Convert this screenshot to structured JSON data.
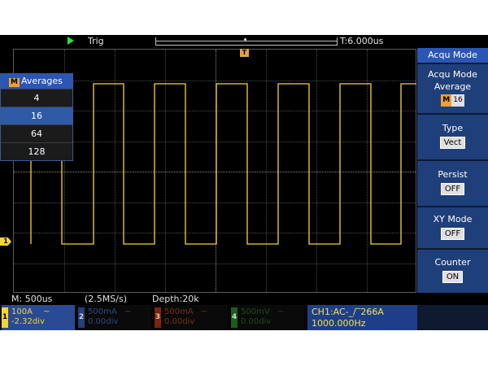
{
  "top": {
    "trigger_status": "Trig",
    "trigger_time": "T:6.000us"
  },
  "markers": {
    "trigger": "T",
    "ch1": "1"
  },
  "averages_menu": {
    "badge": "M",
    "title": "Averages",
    "options": [
      "4",
      "16",
      "64",
      "128"
    ],
    "selected": "16"
  },
  "right_menu": {
    "title": "Acqu Mode",
    "acqu_mode_label": "Acqu Mode",
    "acqu_mode_value": "Average",
    "acqu_mode_badge": "M",
    "acqu_mode_count": "16",
    "type_label": "Type",
    "type_value": "Vect",
    "persist_label": "Persist",
    "persist_value": "OFF",
    "xy_label": "XY Mode",
    "xy_value": "OFF",
    "counter_label": "Counter",
    "counter_value": "ON"
  },
  "info": {
    "timebase": "M: 500us",
    "sample_rate": "(2.5MS/s)",
    "depth": "Depth:20k"
  },
  "channels": [
    {
      "num": "1",
      "scale": "100A",
      "coupling": "~",
      "offset": "-2.32div",
      "color": "#f5d631",
      "active": true
    },
    {
      "num": "2",
      "scale": "500mA",
      "coupling": "~",
      "offset": "0.00div",
      "color": "#3a63b8",
      "active": false
    },
    {
      "num": "3",
      "scale": "500mA",
      "coupling": "~",
      "offset": "0.00div",
      "color": "#b83a1c",
      "active": false
    },
    {
      "num": "4",
      "scale": "500mV",
      "coupling": "~",
      "offset": "0.00div",
      "color": "#2c8a2c",
      "active": false
    }
  ],
  "trigger_info": {
    "line1": "CH1:AC-_/‾266A",
    "frequency": "1000.000Hz"
  },
  "waveform": {
    "type": "square",
    "color": "#f5d631"
  }
}
